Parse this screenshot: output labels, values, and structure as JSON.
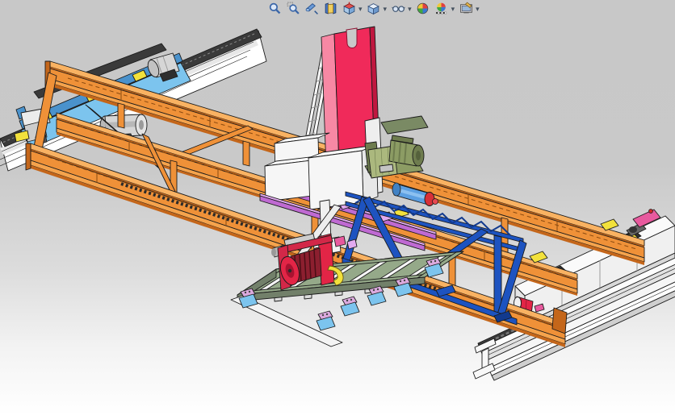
{
  "toolbar": {
    "name": "heads-up-view-toolbar",
    "icons": [
      {
        "name": "zoom-to-fit",
        "dropdown": false
      },
      {
        "name": "zoom-to-area",
        "dropdown": false
      },
      {
        "name": "previous-view",
        "dropdown": false
      },
      {
        "name": "3d-drawing-view",
        "dropdown": false
      },
      {
        "name": "section-view",
        "dropdown": true
      },
      {
        "name": "view-orientation",
        "dropdown": true
      },
      {
        "name": "display-style",
        "dropdown": true
      },
      {
        "name": "edit-appearance",
        "dropdown": false
      },
      {
        "name": "apply-scene",
        "dropdown": true
      },
      {
        "name": "view-settings",
        "dropdown": true
      }
    ]
  },
  "viewport": {
    "background_top": "#c8c8c8",
    "background_bottom": "#ffffff",
    "content": "isometric CAD view of a rail-mounted gantry crane assembly with truss bridge girders, end carriages on I-beam runway rails, center mast column, hoist trolley and lower transfer cart"
  },
  "model": {
    "parts": [
      "runway-rail-left",
      "runway-rail-right",
      "end-carriage-left",
      "end-carriage-right",
      "bridge-girder-rear",
      "bridge-girder-middle",
      "bridge-girder-front",
      "truss-bracing",
      "mast-column",
      "ladder",
      "trolley-housings",
      "drive-motor",
      "hoist-motors",
      "trolley-rails",
      "pneumatic-cylinder",
      "lower-truss-frame",
      "transfer-cart",
      "cart-rollers",
      "cable-drum-wheel"
    ]
  },
  "colors": {
    "outline": "#1b1b1b",
    "orange": "#ef9138",
    "orange_light": "#f9b262",
    "orange_mid": "#f5a34c",
    "orange_dark": "#c4661a",
    "rail_head": "#3a3a3a",
    "carriage_blue": "#7cc4ee",
    "carriage_blue_dark": "#4a92cc",
    "truss_blue": "#1d53c0",
    "truss_blue_dark": "#123a8e",
    "red": "#f02a5a",
    "red_light": "#f788a4",
    "red_dark": "#c0173f",
    "wheel_red": "#e22546",
    "wheel_red_dark": "#8c1f2f",
    "pink": "#e85a9e",
    "olive": "#8c9c64",
    "olive_light": "#abb87e",
    "olive_dark": "#6e7c4e",
    "sage": "#95a989",
    "sage_dark": "#72806a",
    "purple": "#bf6ad2",
    "purple_light": "#e2aaf0",
    "lavender": "#dcaade",
    "yellow": "#f2e13c",
    "gray_motor": "#d6d6d6",
    "steel_blue": "#5b9fe2",
    "cap_red": "#d83038",
    "white_part": "#f6f6f6",
    "white_bright": "#fdfdfd",
    "white_shade": "#e7e7e7",
    "notch_bg": "#c9c9c9"
  }
}
